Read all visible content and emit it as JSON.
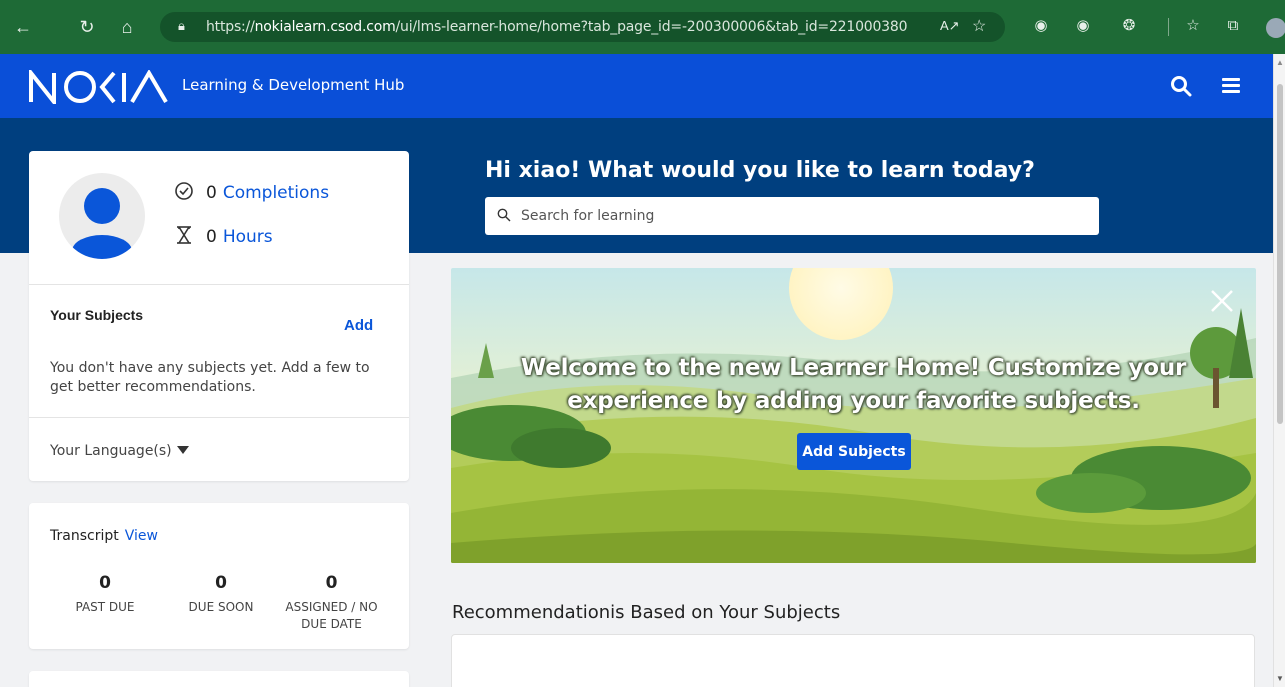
{
  "browser": {
    "url_prefix": "https://",
    "url_domain": "nokialearn.csod.com",
    "url_path": "/ui/lms-learner-home/home?tab_page_id=-200300006&tab_id=221000380"
  },
  "header": {
    "hub_title": "Learning & Development Hub"
  },
  "profile": {
    "completions_count": "0",
    "completions_label": "Completions",
    "hours_count": "0",
    "hours_label": "Hours"
  },
  "subjects": {
    "title": "Your Subjects",
    "add_label": "Add",
    "empty_text": "You don't have any subjects yet. Add a few to get better recommendations.",
    "language_label": "Your Language(s)"
  },
  "transcript": {
    "title": "Transcript",
    "view_label": "View",
    "stats": [
      {
        "value": "0",
        "label": "PAST DUE"
      },
      {
        "value": "0",
        "label": "DUE SOON"
      },
      {
        "value": "0",
        "label": "ASSIGNED / NO DUE DATE"
      }
    ]
  },
  "main": {
    "greeting": "Hi xiao! What would you like to learn today?",
    "search_placeholder": "Search for learning",
    "banner_text": "Welcome to the new Learner Home! Customize your experience by adding your favorite subjects.",
    "banner_button": "Add Subjects",
    "recommendations_title": "Recommendationis Based on Your Subjects"
  },
  "colors": {
    "brand_blue": "#0a4fd8",
    "dark_band": "#003f7f",
    "link_blue": "#0a56d9",
    "browser_green": "#1e6a36"
  },
  "icons": [
    "back-icon",
    "reload-icon",
    "home-icon",
    "lock-icon",
    "read-aloud-icon",
    "favorite-icon",
    "search-icon",
    "menu-icon",
    "check-circle-icon",
    "hourglass-icon",
    "close-icon",
    "caret-down-icon"
  ]
}
